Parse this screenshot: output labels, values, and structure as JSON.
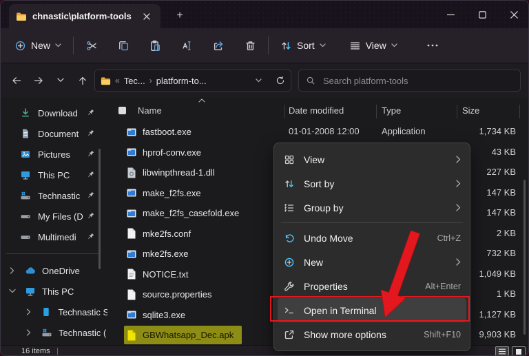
{
  "window": {
    "tab_title": "chnastic\\platform-tools",
    "new_tab_glyph": "+"
  },
  "command_bar": {
    "new_label": "New",
    "sort_label": "Sort",
    "view_label": "View",
    "more_glyph": "•••",
    "icons": [
      "plus-circle-icon",
      "cut-icon",
      "copy-icon",
      "paste-icon",
      "rename-icon",
      "share-icon",
      "delete-icon"
    ]
  },
  "address_bar": {
    "overflow_glyph": "«",
    "crumbs": [
      "Tec...",
      "platform-to..."
    ],
    "crumb_sep": "›",
    "search_placeholder": "Search platform-tools"
  },
  "sidebar": {
    "pinned": [
      {
        "label": "Download",
        "icon": "download-icon"
      },
      {
        "label": "Document",
        "icon": "document-icon"
      },
      {
        "label": "Pictures",
        "icon": "pictures-icon"
      },
      {
        "label": "This PC",
        "icon": "monitor-icon"
      },
      {
        "label": "Technastic",
        "icon": "os-drive-icon"
      },
      {
        "label": "My Files (D",
        "icon": "drive-icon"
      },
      {
        "label": "Multimedi",
        "icon": "drive-icon"
      }
    ],
    "tree": [
      {
        "label": "OneDrive",
        "icon": "cloud-icon",
        "expanded": false,
        "level": 1
      },
      {
        "label": "This PC",
        "icon": "monitor-icon",
        "expanded": true,
        "level": 1
      },
      {
        "label": "Technastic S",
        "icon": "ssd-icon",
        "expanded": false,
        "level": 2
      },
      {
        "label": "Technastic (",
        "icon": "os-drive-icon",
        "expanded": false,
        "level": 2
      }
    ]
  },
  "file_list": {
    "columns": [
      "Name",
      "Date modified",
      "Type",
      "Size"
    ],
    "rows": [
      {
        "name": "fastboot.exe",
        "date": "01-01-2008 12:00",
        "type": "Application",
        "size": "1,734 KB",
        "icon": "exe-file-icon"
      },
      {
        "name": "hprof-conv.exe",
        "date": "",
        "type": "",
        "size": "43 KB",
        "icon": "exe-file-icon"
      },
      {
        "name": "libwinpthread-1.dll",
        "date": "",
        "type": "",
        "size": "227 KB",
        "icon": "dll-file-icon"
      },
      {
        "name": "make_f2fs.exe",
        "date": "",
        "type": "",
        "size": "147 KB",
        "icon": "exe-file-icon"
      },
      {
        "name": "make_f2fs_casefold.exe",
        "date": "",
        "type": "",
        "size": "147 KB",
        "icon": "exe-file-icon"
      },
      {
        "name": "mke2fs.conf",
        "date": "",
        "type": "",
        "size": "2 KB",
        "icon": "doc-file-icon"
      },
      {
        "name": "mke2fs.exe",
        "date": "",
        "type": "",
        "size": "732 KB",
        "icon": "exe-file-icon"
      },
      {
        "name": "NOTICE.txt",
        "date": "",
        "type": "",
        "size": "1,049 KB",
        "icon": "txt-file-icon"
      },
      {
        "name": "source.properties",
        "date": "",
        "type": "",
        "size": "1 KB",
        "icon": "doc-file-icon"
      },
      {
        "name": "sqlite3.exe",
        "date": "",
        "type": "",
        "size": "1,127 KB",
        "icon": "exe-file-icon"
      },
      {
        "name": "GBWhatsapp_Dec.apk",
        "date": "",
        "type": "",
        "size": "9,903 KB",
        "icon": "apk-file-icon",
        "highlighted": true
      }
    ]
  },
  "context_menu": {
    "items": [
      {
        "label": "View",
        "icon": "grid-icon",
        "submenu": true
      },
      {
        "label": "Sort by",
        "icon": "sort-icon",
        "submenu": true
      },
      {
        "label": "Group by",
        "icon": "group-icon",
        "submenu": true
      },
      {
        "label": "Undo Move",
        "icon": "undo-icon",
        "shortcut": "Ctrl+Z"
      },
      {
        "label": "New",
        "icon": "new-icon",
        "submenu": true
      },
      {
        "label": "Properties",
        "icon": "wrench-icon",
        "shortcut": "Alt+Enter"
      },
      {
        "label": "Open in Terminal",
        "icon": "terminal-icon",
        "highlighted": true
      },
      {
        "label": "Show more options",
        "icon": "popout-icon",
        "shortcut": "Shift+F10"
      }
    ],
    "submenu_glyph": "›"
  },
  "status_bar": {
    "items_count": "16 items"
  },
  "annotations": {
    "highlight_color": "#8d8d15",
    "red_color": "#e3181f"
  }
}
